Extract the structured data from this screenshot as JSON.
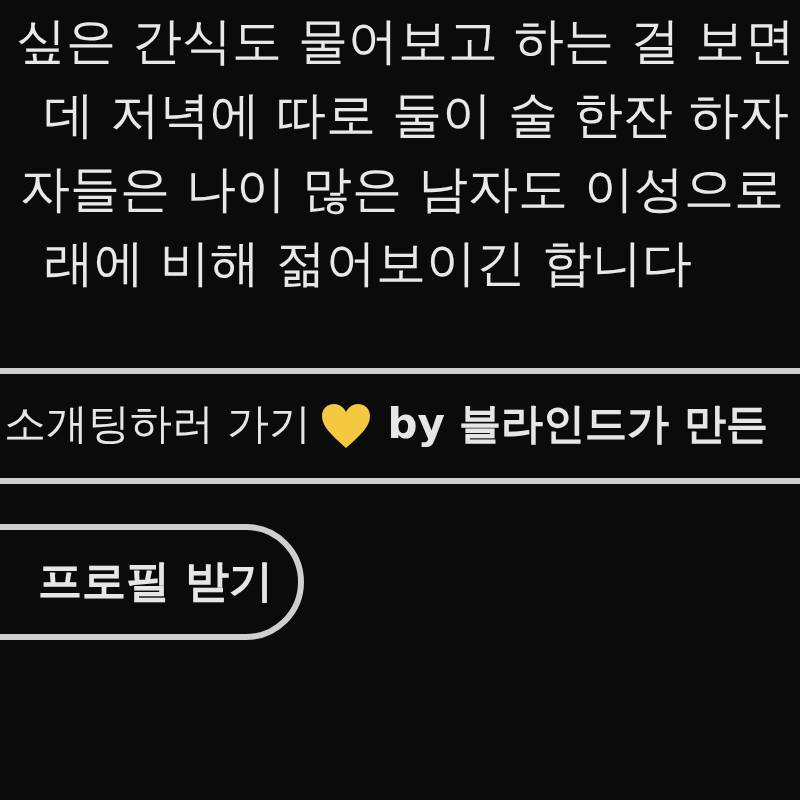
{
  "body_lines": [
    "싶은 간식도 물어보고 하는 걸 보면",
    "데 저녁에 따로 둘이 술 한잔 하자",
    "자들은 나이 많은 남자도 이성으로",
    "래에 비해 젊어보이긴 합니다"
  ],
  "banner": {
    "text": "소개팅하러 가기",
    "by": "by 블라인드가 만든"
  },
  "profile_button": {
    "label": "프로필 받기"
  }
}
